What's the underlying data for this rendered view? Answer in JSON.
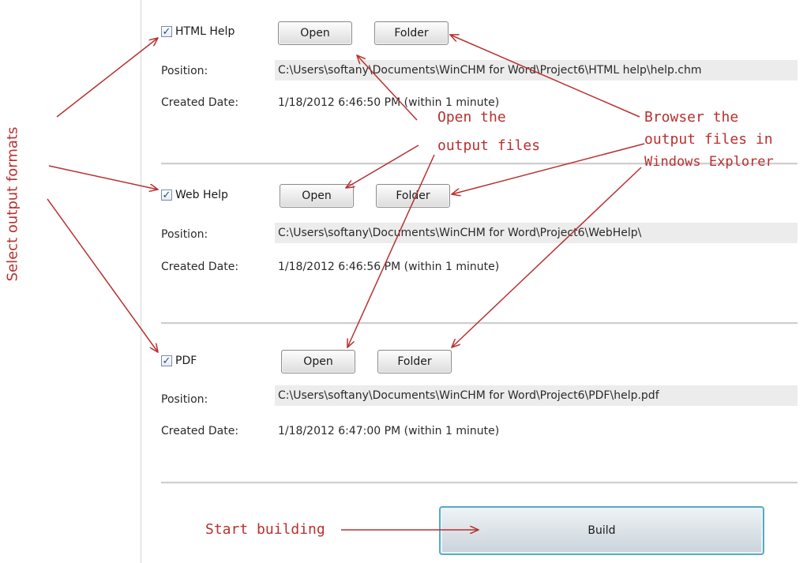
{
  "outputs": [
    {
      "format_label": "HTML Help",
      "checked": true,
      "open_label": "Open",
      "folder_label": "Folder",
      "position_label": "Position:",
      "position_value": "C:\\Users\\softany\\Documents\\WinCHM for Word\\Project6\\HTML help\\help.chm",
      "date_label": "Created Date:",
      "date_value": "1/18/2012 6:46:50 PM (within 1 minute)"
    },
    {
      "format_label": "Web Help",
      "checked": true,
      "open_label": "Open",
      "folder_label": "Folder",
      "position_label": "Position:",
      "position_value": "C:\\Users\\softany\\Documents\\WinCHM for Word\\Project6\\WebHelp\\",
      "date_label": "Created Date:",
      "date_value": "1/18/2012 6:46:56 PM (within 1 minute)"
    },
    {
      "format_label": "PDF",
      "checked": true,
      "open_label": "Open",
      "folder_label": "Folder",
      "position_label": "Position:",
      "position_value": "C:\\Users\\softany\\Documents\\WinCHM for Word\\Project6\\PDF\\help.pdf",
      "date_label": "Created Date:",
      "date_value": "1/18/2012 6:47:00 PM (within 1 minute)"
    }
  ],
  "build_label": "Build",
  "annotations": {
    "select_formats": "Select output formats",
    "open_files_line1": "Open the",
    "open_files_line2": "output files",
    "browse_line1": "Browser the",
    "browse_line2": "output files in",
    "browse_line3": "Windows Explorer",
    "start_building": "Start building"
  },
  "colors": {
    "annotation": "#b83030",
    "build_border": "#5aaac4",
    "position_bg": "#ececec"
  },
  "icons": {
    "checkbox": "check-mark-icon"
  }
}
